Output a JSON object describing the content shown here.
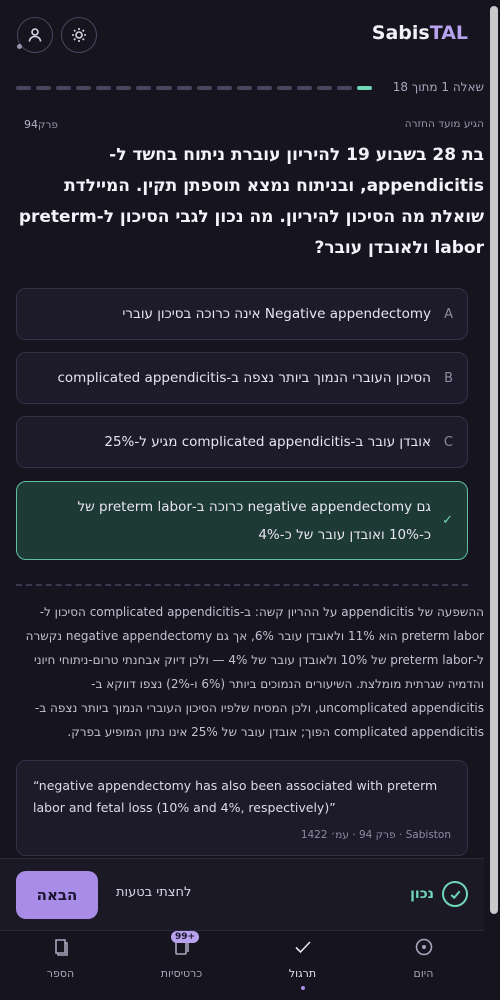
{
  "header": {
    "brand_prefix": "Sabis",
    "brand_accent": "TAL",
    "icons": [
      "user-icon",
      "sun-icon"
    ]
  },
  "progress": {
    "label": "שאלה 1 מתוך 18",
    "current": 1,
    "total": 18
  },
  "question_meta": {
    "topic": "הגיע מועד החזרה",
    "chapter_label": "פרק",
    "chapter_number": "94"
  },
  "question": {
    "text": "בת 28 בשבוע 19 להיריון עוברת ניתוח בחשד ל-appendicitis, ובניתוח נמצא תוספתן תקין. המיילדת שואלת מה הסיכון להיריון. מה נכון לגבי הסיכון ל-preterm labor ולאובדן עובר?"
  },
  "options": [
    {
      "letter": "A",
      "text": "Negative appendectomy אינה כרוכה בסיכון עוברי"
    },
    {
      "letter": "B",
      "text": "הסיכון העוברי הנמוך ביותר נצפה ב-complicated appendicitis"
    },
    {
      "letter": "C",
      "text": "אובדן עובר ב-complicated appendicitis מגיע ל-25%"
    },
    {
      "letter": "✓",
      "text": "גם negative appendectomy כרוכה ב-preterm labor של כ-10% ואובדן עובר של כ-4%"
    }
  ],
  "explanation": "ההשפעה של appendicitis על ההריון קשה: ב-complicated appendicitis הסיכון ל-preterm labor הוא 11% ולאובדן עובר 6%, אך גם negative appendectomy נקשרה ל-preterm labor של 10% ולאובדן עובר של 4% — ולכן דיוק אבחנתי טרום-ניתוחי חיוני והדמיה שגרתית מומלצת. השיעורים הנמוכים ביותר (6% ו-2%) נצפו דווקא ב-uncomplicated appendicitis, ולכן המסיח שלפיו הסיכון העוברי הנמוך ביותר נצפה ב-complicated appendicitis הפוך; אובדן עובר של 25% אינו נתון המופיע בפרק.",
  "quote": {
    "text": "“negative appendectomy has also been associated with preterm labor and fetal loss (10% and 4%, respectively)”",
    "source": "Sabiston · פרק 94 · עמ׳ 1422"
  },
  "actions": {
    "next_label": "הבאה",
    "wrong_label": "לחצתי בטעות",
    "status_label": "נכון"
  },
  "nav": {
    "items": [
      {
        "label": "הספר",
        "icon": "book-icon"
      },
      {
        "label": "כרטיסיות",
        "icon": "cards-icon",
        "badge": "99+"
      },
      {
        "label": "תרגול",
        "icon": "check-icon",
        "active": true
      },
      {
        "label": "היום",
        "icon": "target-icon"
      }
    ]
  },
  "colors": {
    "background": "#16141f",
    "accent": "#b8a2ee",
    "correct": "#6fd6b8",
    "button": "#a98ce8"
  }
}
